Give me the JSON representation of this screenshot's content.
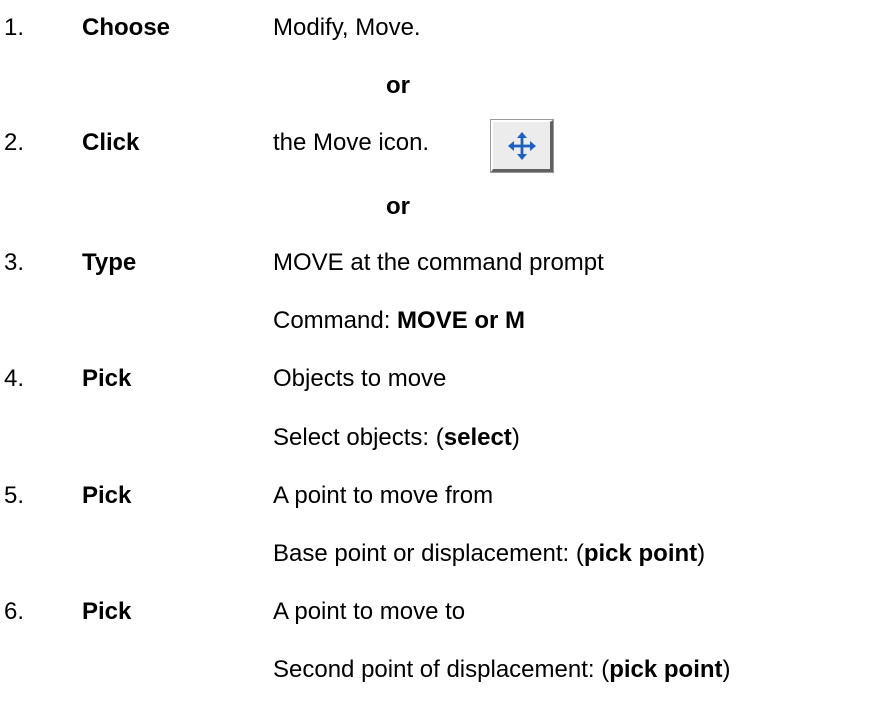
{
  "icon_colors": {
    "move_arrows": "#1f5fbf",
    "button_face": "#ececec"
  },
  "steps": [
    {
      "number": "1.",
      "verb": "Choose",
      "text": "Modify, Move."
    },
    {
      "or": "or"
    },
    {
      "number": "2.",
      "verb": "Click",
      "text": "the Move icon.",
      "icon": "move-icon"
    },
    {
      "or": "or"
    },
    {
      "number": "3.",
      "verb": "Type",
      "text": "MOVE at the command prompt",
      "prompt_label": "Command: ",
      "prompt_value": "MOVE or M"
    },
    {
      "number": "4.",
      "verb": "Pick",
      "text": "Objects to move",
      "prompt_label": "Select objects: (",
      "prompt_value": "select",
      "prompt_close": ")"
    },
    {
      "number": "5.",
      "verb": "Pick",
      "text": "A point to move from",
      "prompt_label": "Base point or displacement: (",
      "prompt_value": "pick point",
      "prompt_close": ")"
    },
    {
      "number": "6.",
      "verb": "Pick",
      "text": "A point to move to",
      "prompt_label": "Second point of displacement: (",
      "prompt_value": "pick point",
      "prompt_close": ")"
    }
  ]
}
